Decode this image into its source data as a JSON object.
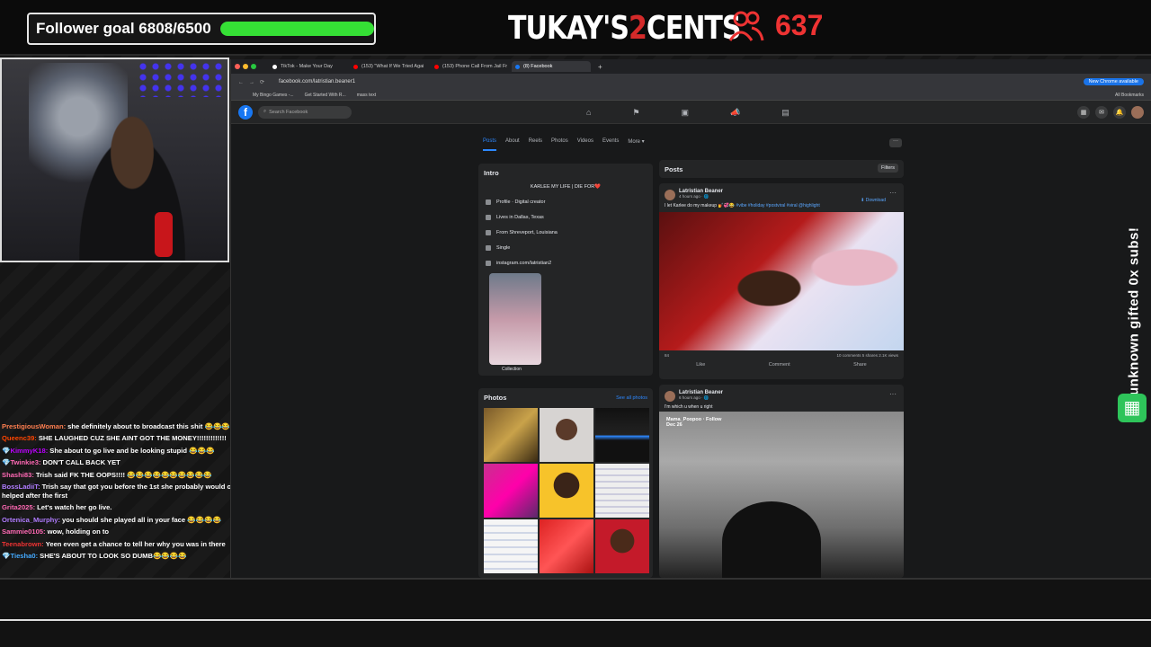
{
  "overlay": {
    "goal_label": "Follower goal 6808/6500",
    "goal_progress": 1.0,
    "logo_a": "TUKAY'S",
    "logo_two": "2",
    "logo_b": "CENTS",
    "viewer_count": "637",
    "side_banner": "unknown gifted 0x subs!"
  },
  "chat": [
    {
      "user": "PrestigiousWoman:",
      "text": "she definitely about to broadcast this shit 😂😂😂",
      "color": "#ff7f50"
    },
    {
      "user": "Queenc39:",
      "text": "SHE LAUGHED CUZ SHE AINT GOT THE MONEY!!!!!!!!!!!!!",
      "color": "#ff4500"
    },
    {
      "user": "💎KimmyK18:",
      "text": "She about to go live and be looking stupid 😂😂😂",
      "color": "#b0f"
    },
    {
      "user": "💎Twinkie3:",
      "text": "DON'T CALL BACK YET",
      "color": "#ff69b4"
    },
    {
      "user": "Shashi83:",
      "text": "Trish said FK THE OOPS!!!! 😂😂😂😂😂😂😂😂😂😂",
      "color": "#ff69b4"
    },
    {
      "user": "BossLadiiT:",
      "text": "Trish say that got you before the 1st she probably would of helped after the first",
      "color": "#b07cff"
    },
    {
      "user": "Grita2025:",
      "text": "Let's watch her go live.",
      "color": "#ff69b4"
    },
    {
      "user": "Ortenica_Murphy:",
      "text": "you should she played all in your face 😂😂😂😂",
      "color": "#b07cff"
    },
    {
      "user": "Sammie0105:",
      "text": "wow, holding on to",
      "color": "#ff69b4"
    },
    {
      "user": "Teenabrown:",
      "text": "Yeen even get a chance to tell her why you was in there",
      "color": "#e33"
    },
    {
      "user": "💎Tiesha0:",
      "text": "SHE'S ABOUT TO LOOK SO DUMB😂😂😂😂",
      "color": "#4af"
    }
  ],
  "browser": {
    "tabs": [
      "TikTok - Make Your Day",
      "(153) \"What If We Tried Agai",
      "(153) Phone Call From Jail Fr",
      "(8) Facebook"
    ],
    "url": "facebook.com/latristian.beaner1",
    "new_chrome": "New Chrome available",
    "bookmarks": [
      "My Bingo Games -...",
      "Get Started With R...",
      "mass text"
    ],
    "all_bookmarks": "All Bookmarks"
  },
  "fb": {
    "search_placeholder": "Search Facebook",
    "profile_tabs": [
      "Posts",
      "About",
      "Reels",
      "Photos",
      "Videos",
      "Events",
      "More ▾"
    ],
    "intro": {
      "title": "Intro",
      "bio": "KARLEE MY LIFE | DIE FOR❤️",
      "rows": [
        "Profile · Digital creator",
        "Lives in Dallas, Texas",
        "From Shreveport, Louisiana",
        "Single",
        "instagram.com/latristian2"
      ],
      "featured_caption": "Collection"
    },
    "photos": {
      "title": "Photos",
      "see_all": "See all photos"
    },
    "posts": {
      "title": "Posts",
      "filters": "Filters"
    },
    "post1": {
      "name": "Latristian Beaner",
      "meta": "4 hours ago · 🌐",
      "text": "I let Karlee do my makeup 💅💞😂",
      "tags": "#vibe #holiday #postviral #viral @highlight",
      "download": "⬇ Download",
      "reactions": "84",
      "stats": "10 comments  5 shares  2.1K views",
      "like": "Like",
      "comment": "Comment",
      "share": "Share"
    },
    "post2": {
      "name": "Latristian Beaner",
      "meta": "6 hours ago · 🌐",
      "text": "I'm which u when u right",
      "video_user": "Mama_Poopoo · Follow",
      "video_date": "Dec 26"
    }
  }
}
